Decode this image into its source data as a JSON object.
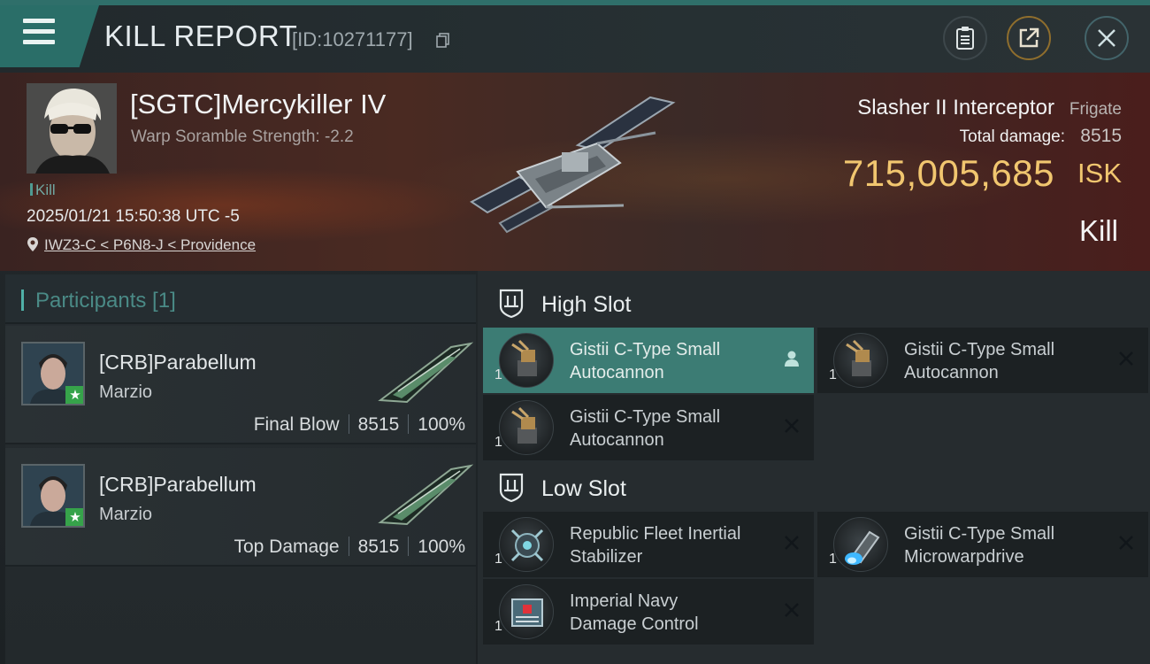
{
  "header": {
    "title": "KILL REPORT",
    "report_id": "[ID:10271177]"
  },
  "victim": {
    "pilot_name": "[SGTC]Mercykiller IV",
    "scramble_text": "Warp Soramble Strength: -2.2",
    "kill_tag": "Kill",
    "datetime": "2025/01/21 15:50:38 UTC -5",
    "location": "IWZ3-C < P6N8-J < Providence",
    "ship_name": "Slasher II Interceptor",
    "ship_class": "Frigate",
    "total_damage_label": "Total damage:",
    "total_damage_value": "8515",
    "isk_value": "715,005,685",
    "isk_unit": "ISK",
    "result": "Kill"
  },
  "participants": {
    "title": "Participants [1]",
    "items": [
      {
        "name": "[CRB]Parabellum",
        "corp": "Marzio",
        "role": "Final Blow",
        "damage": "8515",
        "percent": "100%"
      },
      {
        "name": "[CRB]Parabellum",
        "corp": "Marzio",
        "role": "Top Damage",
        "damage": "8515",
        "percent": "100%"
      }
    ]
  },
  "slots": {
    "high": {
      "label": "High Slot",
      "modules": [
        {
          "line1": "Gistii C-Type Small",
          "line2": "Autocannon",
          "qty": "1",
          "action_icon": "person-icon"
        },
        {
          "line1": "Gistii C-Type Small",
          "line2": "Autocannon",
          "qty": "1",
          "action_icon": "close-icon"
        },
        {
          "line1": "Gistii C-Type Small",
          "line2": "Autocannon",
          "qty": "1",
          "action_icon": "close-icon"
        }
      ]
    },
    "low": {
      "label": "Low Slot",
      "modules": [
        {
          "line1": "Republic Fleet Inertial",
          "line2": "Stabilizer",
          "qty": "1",
          "action_icon": "close-icon"
        },
        {
          "line1": "Gistii C-Type Small",
          "line2": "Microwarpdrive",
          "qty": "1",
          "action_icon": "close-icon"
        },
        {
          "line1": "Imperial Navy",
          "line2": "Damage Control",
          "qty": "1",
          "action_icon": "close-icon"
        }
      ]
    }
  },
  "colors": {
    "accent": "#2a6e68",
    "isk": "#f1c66f",
    "active_module": "#3c7c74"
  }
}
